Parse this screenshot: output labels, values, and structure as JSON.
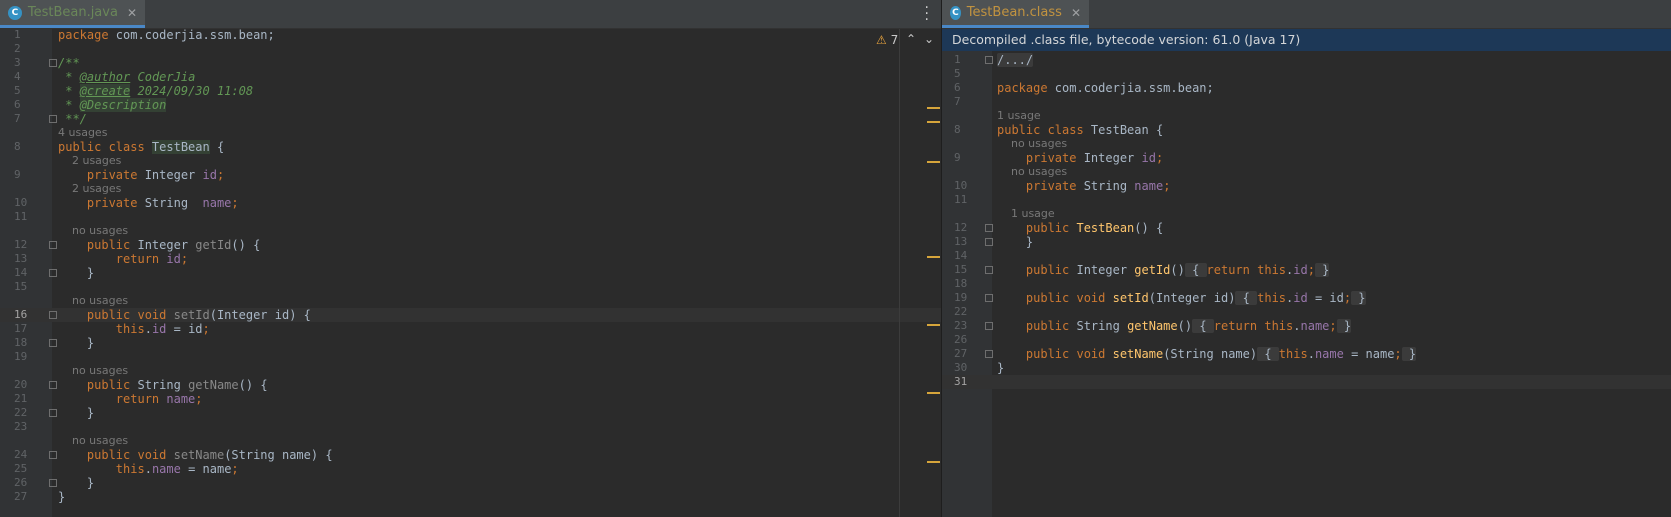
{
  "left": {
    "tab": {
      "label": "TestBean.java",
      "icon": "class-c-icon"
    },
    "warnings_count": "7",
    "lines": [
      {
        "n": "1",
        "tokens": [
          [
            "kw",
            "package "
          ],
          [
            "",
            "com.coderjia.ssm.bean;"
          ]
        ]
      },
      {
        "n": "2",
        "tokens": []
      },
      {
        "n": "3",
        "tokens": [
          [
            "doc",
            "/**"
          ]
        ]
      },
      {
        "n": "4",
        "tokens": [
          [
            "doc",
            " * "
          ],
          [
            "doc tag",
            "@author"
          ],
          [
            "doc",
            " CoderJia"
          ]
        ]
      },
      {
        "n": "5",
        "tokens": [
          [
            "doc",
            " * "
          ],
          [
            "doc tag hl",
            "@create"
          ],
          [
            "doc",
            " 2024/09/30 11:08"
          ]
        ]
      },
      {
        "n": "6",
        "tokens": [
          [
            "doc",
            " * "
          ],
          [
            "doc hl",
            "@Description"
          ]
        ]
      },
      {
        "n": "7",
        "tokens": [
          [
            "doc",
            " **/"
          ]
        ]
      },
      {
        "hint": "4 usages",
        "indent": 0
      },
      {
        "n": "8",
        "tokens": [
          [
            "kw",
            "public class "
          ],
          [
            "hl",
            "TestBean"
          ],
          [
            "",
            " {"
          ]
        ]
      },
      {
        "hint": "2 usages",
        "indent": 4
      },
      {
        "n": "9",
        "tokens": [
          [
            "",
            "    "
          ],
          [
            "kw",
            "private "
          ],
          [
            "",
            "Integer "
          ],
          [
            "fld",
            "id"
          ],
          [
            "kw",
            ";"
          ]
        ]
      },
      {
        "hint": "2 usages",
        "indent": 4
      },
      {
        "n": "10",
        "tokens": [
          [
            "",
            "    "
          ],
          [
            "kw",
            "private "
          ],
          [
            "",
            "String  "
          ],
          [
            "fld",
            "name"
          ],
          [
            "kw",
            ";"
          ]
        ]
      },
      {
        "n": "11",
        "tokens": []
      },
      {
        "hint": "no usages",
        "indent": 4
      },
      {
        "n": "12",
        "tokens": [
          [
            "",
            "    "
          ],
          [
            "kw",
            "public "
          ],
          [
            "",
            "Integer "
          ],
          [
            "unused",
            "getId"
          ],
          [
            "",
            "() {"
          ]
        ]
      },
      {
        "n": "13",
        "tokens": [
          [
            "",
            "        "
          ],
          [
            "kw",
            "return "
          ],
          [
            "fld",
            "id"
          ],
          [
            "kw",
            ";"
          ]
        ]
      },
      {
        "n": "14",
        "tokens": [
          [
            "",
            "    }"
          ]
        ]
      },
      {
        "n": "15",
        "tokens": []
      },
      {
        "hint": "no usages",
        "indent": 4
      },
      {
        "n": "16",
        "current": true,
        "tokens": [
          [
            "",
            "    "
          ],
          [
            "kw",
            "public void "
          ],
          [
            "unused",
            "setId"
          ],
          [
            "",
            "(Integer id) {"
          ]
        ]
      },
      {
        "n": "17",
        "tokens": [
          [
            "",
            "        "
          ],
          [
            "kw",
            "this"
          ],
          [
            "",
            "."
          ],
          [
            "fld",
            "id"
          ],
          [
            "",
            " = id"
          ],
          [
            "kw",
            ";"
          ]
        ]
      },
      {
        "n": "18",
        "tokens": [
          [
            "",
            "    }"
          ]
        ]
      },
      {
        "n": "19",
        "tokens": []
      },
      {
        "hint": "no usages",
        "indent": 4
      },
      {
        "n": "20",
        "tokens": [
          [
            "",
            "    "
          ],
          [
            "kw",
            "public "
          ],
          [
            "",
            "String "
          ],
          [
            "unused",
            "getName"
          ],
          [
            "",
            "() {"
          ]
        ]
      },
      {
        "n": "21",
        "tokens": [
          [
            "",
            "        "
          ],
          [
            "kw",
            "return "
          ],
          [
            "fld",
            "name"
          ],
          [
            "kw",
            ";"
          ]
        ]
      },
      {
        "n": "22",
        "tokens": [
          [
            "",
            "    }"
          ]
        ]
      },
      {
        "n": "23",
        "tokens": []
      },
      {
        "hint": "no usages",
        "indent": 4
      },
      {
        "n": "24",
        "tokens": [
          [
            "",
            "    "
          ],
          [
            "kw",
            "public void "
          ],
          [
            "unused",
            "setName"
          ],
          [
            "",
            "(String name) {"
          ]
        ]
      },
      {
        "n": "25",
        "tokens": [
          [
            "",
            "        "
          ],
          [
            "kw",
            "this"
          ],
          [
            "",
            "."
          ],
          [
            "fld",
            "name"
          ],
          [
            "",
            " = name"
          ],
          [
            "kw",
            ";"
          ]
        ]
      },
      {
        "n": "26",
        "tokens": [
          [
            "",
            "    }"
          ]
        ]
      },
      {
        "n": "27",
        "tokens": [
          [
            "",
            "}"
          ]
        ]
      }
    ]
  },
  "right": {
    "tab": {
      "label": "TestBean.class",
      "icon": "class-c-icon"
    },
    "banner": "Decompiled .class file, bytecode version: 61.0 (Java 17)",
    "lines": [
      {
        "n": "1",
        "tokens": [
          [
            "cbox",
            "/.../"
          ]
        ]
      },
      {
        "n": "5",
        "tokens": []
      },
      {
        "n": "6",
        "tokens": [
          [
            "kw",
            "package "
          ],
          [
            "",
            "com.coderjia.ssm.bean;"
          ]
        ]
      },
      {
        "n": "7",
        "tokens": []
      },
      {
        "hint": "1 usage",
        "indent": 0
      },
      {
        "n": "8",
        "tokens": [
          [
            "kw",
            "public class "
          ],
          [
            "",
            "TestBean {"
          ]
        ]
      },
      {
        "hint": "no usages",
        "indent": 4
      },
      {
        "n": "9",
        "tokens": [
          [
            "",
            "    "
          ],
          [
            "kw",
            "private "
          ],
          [
            "",
            "Integer "
          ],
          [
            "fld",
            "id"
          ],
          [
            "kw",
            ";"
          ]
        ]
      },
      {
        "hint": "no usages",
        "indent": 4
      },
      {
        "n": "10",
        "tokens": [
          [
            "",
            "    "
          ],
          [
            "kw",
            "private "
          ],
          [
            "",
            "String "
          ],
          [
            "fld",
            "name"
          ],
          [
            "kw",
            ";"
          ]
        ]
      },
      {
        "n": "11",
        "tokens": []
      },
      {
        "hint": "1 usage",
        "indent": 4
      },
      {
        "n": "12",
        "tokens": [
          [
            "",
            "    "
          ],
          [
            "kw",
            "public "
          ],
          [
            "fn",
            "TestBean"
          ],
          [
            "",
            "() {"
          ]
        ]
      },
      {
        "n": "13",
        "tokens": [
          [
            "",
            "    }"
          ]
        ]
      },
      {
        "n": "14",
        "tokens": []
      },
      {
        "n": "15",
        "tokens": [
          [
            "",
            "    "
          ],
          [
            "kw",
            "public "
          ],
          [
            "",
            "Integer "
          ],
          [
            "fn",
            "getId"
          ],
          [
            "",
            "()"
          ],
          [
            "cbox",
            " { "
          ],
          [
            "kw",
            "return this"
          ],
          [
            "",
            "."
          ],
          [
            "fld",
            "id"
          ],
          [
            "kw",
            ";"
          ],
          [
            "cbox",
            " }"
          ]
        ]
      },
      {
        "n": "18",
        "tokens": []
      },
      {
        "n": "19",
        "tokens": [
          [
            "",
            "    "
          ],
          [
            "kw",
            "public void "
          ],
          [
            "fn",
            "setId"
          ],
          [
            "",
            "(Integer id)"
          ],
          [
            "cbox",
            " { "
          ],
          [
            "kw",
            "this"
          ],
          [
            "",
            "."
          ],
          [
            "fld",
            "id"
          ],
          [
            "",
            " = id"
          ],
          [
            "kw",
            ";"
          ],
          [
            "cbox",
            " }"
          ]
        ]
      },
      {
        "n": "22",
        "tokens": []
      },
      {
        "n": "23",
        "tokens": [
          [
            "",
            "    "
          ],
          [
            "kw",
            "public "
          ],
          [
            "",
            "String "
          ],
          [
            "fn",
            "getName"
          ],
          [
            "",
            "()"
          ],
          [
            "cbox",
            " { "
          ],
          [
            "kw",
            "return this"
          ],
          [
            "",
            "."
          ],
          [
            "fld",
            "name"
          ],
          [
            "kw",
            ";"
          ],
          [
            "cbox",
            " }"
          ]
        ]
      },
      {
        "n": "26",
        "tokens": []
      },
      {
        "n": "27",
        "tokens": [
          [
            "",
            "    "
          ],
          [
            "kw",
            "public void "
          ],
          [
            "fn",
            "setName"
          ],
          [
            "",
            "(String name)"
          ],
          [
            "cbox",
            " { "
          ],
          [
            "kw",
            "this"
          ],
          [
            "",
            "."
          ],
          [
            "fld",
            "name"
          ],
          [
            "",
            " = name"
          ],
          [
            "kw",
            ";"
          ],
          [
            "cbox",
            " }"
          ]
        ]
      },
      {
        "n": "30",
        "tokens": [
          [
            "",
            "}"
          ]
        ]
      },
      {
        "n": "31",
        "current": true,
        "tokens": []
      }
    ]
  },
  "colors": {
    "keyword": "#cc7832",
    "field": "#9876aa",
    "method": "#ffc66d",
    "doc": "#629755",
    "marker": "#d6a53b"
  }
}
